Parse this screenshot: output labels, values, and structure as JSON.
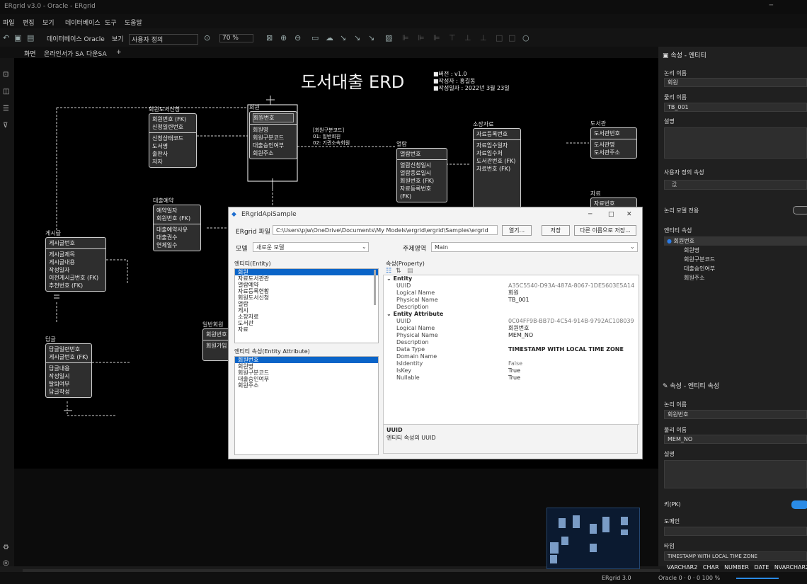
{
  "window": {
    "title": "ERgrid v3.0 - Oracle - ERgrid"
  },
  "menu": [
    "파일",
    "편집",
    "보기",
    "데이터베이스",
    "도구",
    "도움말"
  ],
  "toolbar": {
    "db_label": "데이터베이스 Oracle",
    "view_label": "보기",
    "view_select": "사용자 정의",
    "zoom": "70 %"
  },
  "tabs": [
    "화면",
    "온라인서가 SA",
    "다운SA",
    "+"
  ],
  "diagram": {
    "title": "도서대출 ERD",
    "meta": [
      "■버전 : v1.0",
      "■작성자 : 홍길동",
      "■작성일자 : 2022년 3월 23일"
    ],
    "note": [
      "[회원구분코드]",
      "01: 일반회원",
      "02: 기관소속회원"
    ],
    "entities": [
      {
        "name": "회원도서신청",
        "pk": [
          "회원번호 (FK)",
          "신청일련번호"
        ],
        "attrs": [
          "신청상태코드",
          "도서명",
          "출판사",
          "저자"
        ]
      },
      {
        "name": "회원",
        "pk": [
          "회원번호"
        ],
        "attrs": [
          "회원명",
          "회원구분코드",
          "대출승인여부",
          "회원주소"
        ]
      },
      {
        "name": "열람",
        "pk": [
          "열람번호"
        ],
        "attrs": [
          "열람신청일시",
          "열람종료일시",
          "회원번호 (FK)",
          "자료등록번호 (FK)"
        ]
      },
      {
        "name": "소장자료",
        "pk": [
          "자료등록번호"
        ],
        "attrs": [
          "자료입수일자",
          "자료입수처",
          "도서관번호 (FK)",
          "자료번호 (FK)"
        ]
      },
      {
        "name": "도서관",
        "pk": [
          "도서관번호"
        ],
        "attrs": [
          "도서관명",
          "도서관주소"
        ]
      },
      {
        "name": "자료",
        "pk": [
          "자료번호"
        ],
        "attrs": []
      },
      {
        "name": "대출예약",
        "pk": [
          "예약일자",
          "회원번호 (FK)"
        ],
        "attrs": [
          "대출예약사유",
          "대출권수",
          "연체일수"
        ]
      },
      {
        "name": "게시글",
        "pk": [
          "게시글번호"
        ],
        "attrs": [
          "게시글제목",
          "게시글내용",
          "작성일자",
          "이전게시글번호 (FK)",
          "추천번호 (FK)"
        ]
      },
      {
        "name": "답글",
        "pk": [
          "답글일련번호",
          "게시글번호 (FK)"
        ],
        "attrs": [
          "답글내용",
          "작성일시",
          "탈퇴여부",
          "답글작성"
        ]
      },
      {
        "name": "일반회원",
        "pk": [
          "회원번호"
        ],
        "attrs": [
          "회원가입"
        ]
      }
    ]
  },
  "dialog": {
    "title": "ERgridApiSample",
    "file_label": "ERgrid 파일",
    "file_value": "C:\\Users\\pjw\\OneDrive\\Documents\\My Models\\ergrid\\ergrid\\Samples\\ergrid",
    "open_btn": "열기...",
    "save_btn": "저장",
    "save_as_btn": "다른 이름으로 저장...",
    "model_label": "모델",
    "model_value": "새로운 모델",
    "subject_label": "주제영역",
    "subject_value": "Main",
    "entity_list_label": "엔티티(Entity)",
    "entity_list": [
      "회원",
      "자료도서관관",
      "열람예약",
      "자료등록현황",
      "회원도서신청",
      "열람",
      "게시",
      "소장자료",
      "도서관",
      "자료"
    ],
    "attr_list_label": "엔티티 속성(Entity Attribute)",
    "attr_list": [
      "회원번호",
      "회원명",
      "회원구분코드",
      "대출승인여부",
      "회원주소"
    ],
    "prop_label": "속성(Property)",
    "props": [
      {
        "group": "Entity"
      },
      {
        "k": "UUID",
        "v": "A35C5540-D93A-487A-8067-1DE5603E5A14",
        "dim": true
      },
      {
        "k": "Logical Name",
        "v": "회원"
      },
      {
        "k": "Physical Name",
        "v": "TB_001"
      },
      {
        "k": "Description",
        "v": ""
      },
      {
        "group": "Entity Attribute"
      },
      {
        "k": "UUID",
        "v": "0C04FF9B-BB7D-4C54-914B-9792AC108039",
        "dim": true
      },
      {
        "k": "Logical Name",
        "v": "회원번호"
      },
      {
        "k": "Physical Name",
        "v": "MEM_NO"
      },
      {
        "k": "Description",
        "v": ""
      },
      {
        "k": "Data Type",
        "v": "TIMESTAMP WITH LOCAL TIME ZONE"
      },
      {
        "k": "Domain Name",
        "v": ""
      },
      {
        "k": "IsIdentity",
        "v": "False",
        "dim": true
      },
      {
        "k": "IsKey",
        "v": "True"
      },
      {
        "k": "Nullable",
        "v": "True"
      }
    ],
    "desc_title": "UUID",
    "desc_text": "엔티티 속성의 UUID"
  },
  "right_panel": {
    "header": "속성 - 엔티티",
    "logical_label": "논리 이름",
    "logical_value": "회원",
    "physical_label": "물리 이름",
    "physical_value": "TB_001",
    "desc_label": "설명",
    "udp_label": "사용자 정의 속성",
    "udp_value": "값",
    "logical_only_label": "논리 모델 전용",
    "attr_label": "엔티티 속성",
    "attrs": [
      "회원번호",
      "회원명",
      "회원구분코드",
      "대출승인여부",
      "회원주소"
    ],
    "sub_header": "속성 - 엔티티 속성",
    "sub_logical_label": "논리 이름",
    "sub_logical_value": "회원번호",
    "sub_physical_label": "물리 이름",
    "sub_physical_value": "MEM_NO",
    "sub_desc_label": "설명",
    "key_label": "키(PK)",
    "domain_label": "도메인",
    "type_label": "타입",
    "type_value": "TIMESTAMP WITH LOCAL TIME ZONE",
    "types": [
      "VARCHAR2",
      "CHAR",
      "NUMBER",
      "DATE",
      "NVARCHAR2"
    ]
  },
  "status": {
    "left": "ERgrid 3.0",
    "right": "Oracle 0 · 0 · 0   100 %"
  }
}
